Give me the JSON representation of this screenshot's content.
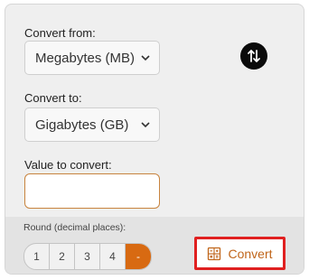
{
  "converter": {
    "from_label": "Convert from:",
    "from_selected": "Megabytes (MB)",
    "to_label": "Convert to:",
    "to_selected": "Gigabytes (GB)",
    "value_label": "Value to convert:",
    "value": "",
    "swap_icon": "swap-vertical-arrows-icon"
  },
  "rounding": {
    "label": "Round (decimal places):",
    "options": [
      "1",
      "2",
      "3",
      "4",
      "-"
    ],
    "selected": "-"
  },
  "convert_button": {
    "label": "Convert",
    "icon": "calculator-icon"
  },
  "colors": {
    "accent": "#d86a12",
    "highlight_border": "#e02020"
  }
}
